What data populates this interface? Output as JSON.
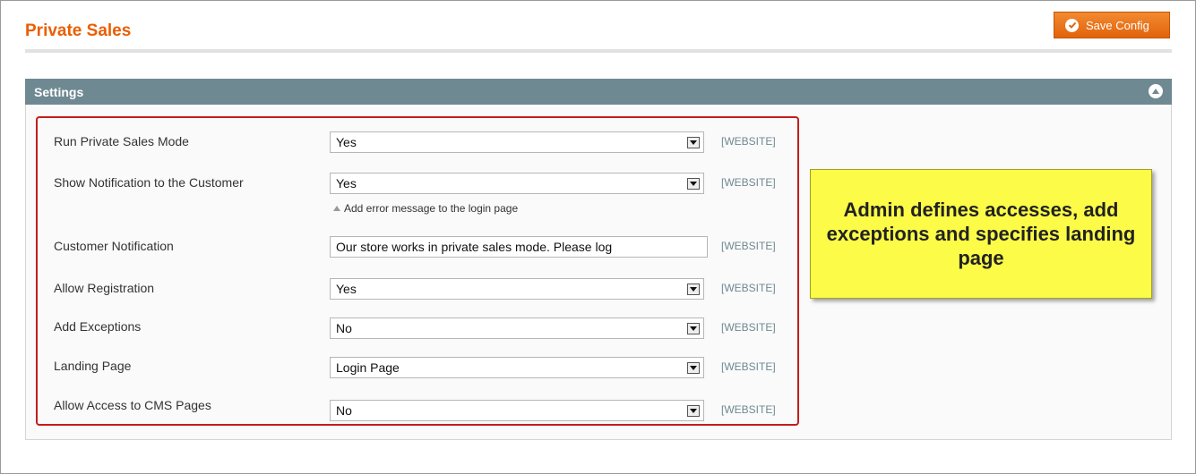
{
  "header": {
    "title": "Private Sales",
    "save_label": "Save Config"
  },
  "section": {
    "title": "Settings"
  },
  "fields": [
    {
      "label": "Run Private Sales Mode",
      "value": "Yes",
      "scope": "[WEBSITE]"
    },
    {
      "label": "Show Notification to the Customer",
      "value": "Yes",
      "scope": "[WEBSITE]",
      "note": "Add error message to the login page"
    },
    {
      "label": "Customer Notification",
      "value": "Our store works in private sales mode. Please log",
      "scope": "[WEBSITE]"
    },
    {
      "label": "Allow Registration",
      "value": "Yes",
      "scope": "[WEBSITE]"
    },
    {
      "label": "Add Exceptions",
      "value": "No",
      "scope": "[WEBSITE]"
    },
    {
      "label": "Landing Page",
      "value": "Login Page",
      "scope": "[WEBSITE]"
    },
    {
      "label": "Allow Access to CMS Pages",
      "value": "No",
      "scope": "[WEBSITE]"
    }
  ],
  "callout": {
    "text": "Admin defines accesses, add exceptions and specifies landing page"
  },
  "colors": {
    "title_orange": "#eb5e00",
    "section_header": "#6f8992",
    "highlight_red": "#c21d1d",
    "callout_yellow": "#fbfb48"
  },
  "icons": {
    "save": "check-circle-icon",
    "collapse": "collapse-up-icon",
    "dropdown": "chevron-down-icon",
    "note": "triangle-up-icon"
  }
}
